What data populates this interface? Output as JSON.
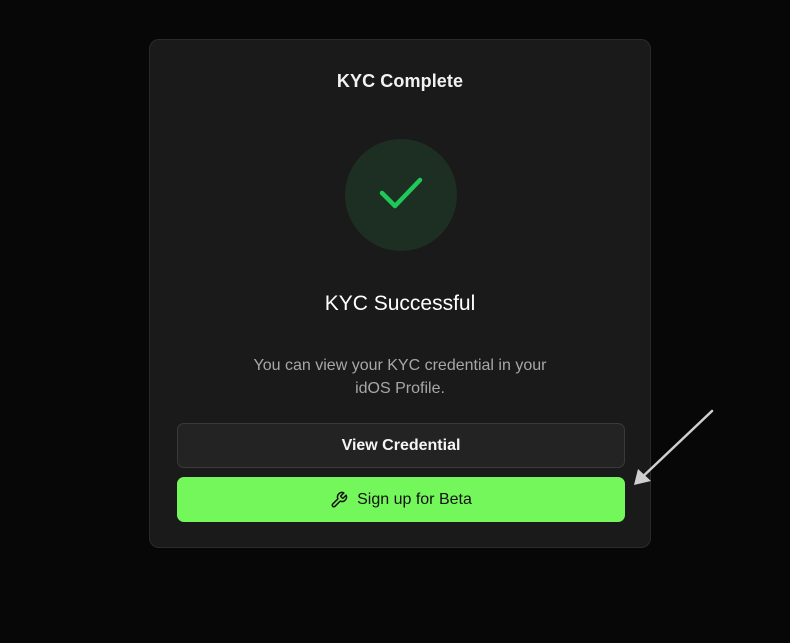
{
  "card": {
    "title": "KYC Complete",
    "status_icon": "check-icon",
    "result_heading": "KYC Successful",
    "description": "You can view your KYC credential in your idOS Profile."
  },
  "actions": {
    "view_credential_label": "View Credential",
    "signup_label": "Sign up for Beta",
    "signup_icon": "wrench-icon"
  },
  "colors": {
    "background": "#070707",
    "card": "#1a1a1a",
    "accent_green": "#74f75b",
    "check_green": "#20c85a",
    "success_circle": "#1d2f22"
  }
}
